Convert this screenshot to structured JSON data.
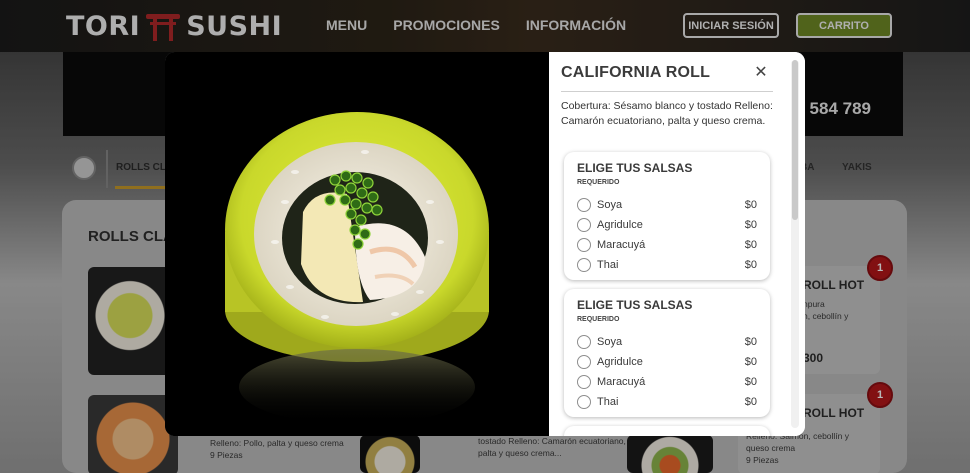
{
  "header": {
    "logo_left": "TORI",
    "logo_right": "SUSHI",
    "nav": [
      "MENU",
      "PROMOCIONES",
      "INFORMACIÓN"
    ],
    "login_label": "INICIAR SESIÓN",
    "cart_label": "CARRITO",
    "accent_color": "#6f8a26"
  },
  "banner": {
    "phone_partial": "584 789"
  },
  "categories": {
    "active": "ROLLS CLÁ",
    "right_items": [
      "BA",
      "YAKIS"
    ]
  },
  "content": {
    "section_title": "ROLLS CLÁ",
    "cards": [
      {
        "title": "ROLL HOT",
        "desc": "npura\nn, cebollín y",
        "price": "300",
        "badge": "1"
      },
      {
        "title": "ROLL HOT",
        "desc": "Relleno: Salmón, cebollín y\nqueso crema\n9 Piezas",
        "badge": "1"
      },
      {
        "desc": "Relleno: Pollo, palta y queso\ncrema\n9 Piezas"
      },
      {
        "desc": "tostado\nRelleno: Camarón ecuatoriano,\npalta y queso crema..."
      }
    ]
  },
  "modal": {
    "title": "CALIFORNIA ROLL",
    "close_label": "✕",
    "description": "Cobertura: Sésamo blanco y tostado Relleno: Camarón ecuatoriano, palta y queso crema.",
    "sauce_groups": [
      {
        "title": "ELIGE TUS SALSAS",
        "required": "REQUERIDO",
        "options": [
          {
            "name": "Soya",
            "price": "$0"
          },
          {
            "name": "Agridulce",
            "price": "$0"
          },
          {
            "name": "Maracuyá",
            "price": "$0"
          },
          {
            "name": "Thai",
            "price": "$0"
          }
        ]
      },
      {
        "title": "ELIGE TUS SALSAS",
        "required": "REQUERIDO",
        "options": [
          {
            "name": "Soya",
            "price": "$0"
          },
          {
            "name": "Agridulce",
            "price": "$0"
          },
          {
            "name": "Maracuyá",
            "price": "$0"
          },
          {
            "name": "Thai",
            "price": "$0"
          }
        ]
      }
    ]
  }
}
